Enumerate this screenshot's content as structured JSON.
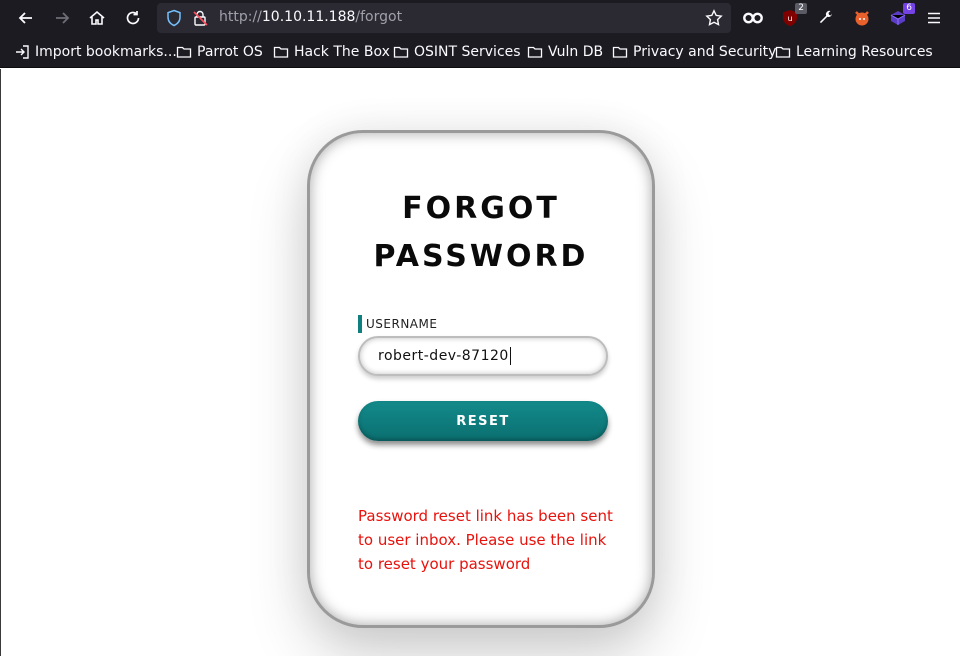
{
  "browser": {
    "url_scheme": "http://",
    "url_host": "10.10.11.188",
    "url_path": "/forgot",
    "extensions": {
      "ublock_badge": "2",
      "purple_ext_badge": "6"
    },
    "icons": [
      "back-icon",
      "forward-icon",
      "home-icon",
      "reload-icon",
      "shield-icon",
      "lock-icon",
      "star-icon",
      "mask-icon",
      "ublock-icon",
      "wrench-icon",
      "fox-icon",
      "cube-icon",
      "menu-icon"
    ]
  },
  "bookmarks": [
    {
      "label": "Import bookmarks..."
    },
    {
      "label": "Parrot OS"
    },
    {
      "label": "Hack The Box"
    },
    {
      "label": "OSINT Services"
    },
    {
      "label": "Vuln DB"
    },
    {
      "label": "Privacy and Security"
    },
    {
      "label": "Learning Resources"
    }
  ],
  "page": {
    "title_line1": "FORGOT",
    "title_line2": "PASSWORD",
    "username_label": "USERNAME",
    "username_value": "robert-dev-87120",
    "reset_label": "RESET",
    "message": "Password reset link has been sent to user inbox. Please use the link to reset your password"
  },
  "colors": {
    "accent": "#0f7f80",
    "message": "#e8120c",
    "chrome": "#1c1b22"
  }
}
